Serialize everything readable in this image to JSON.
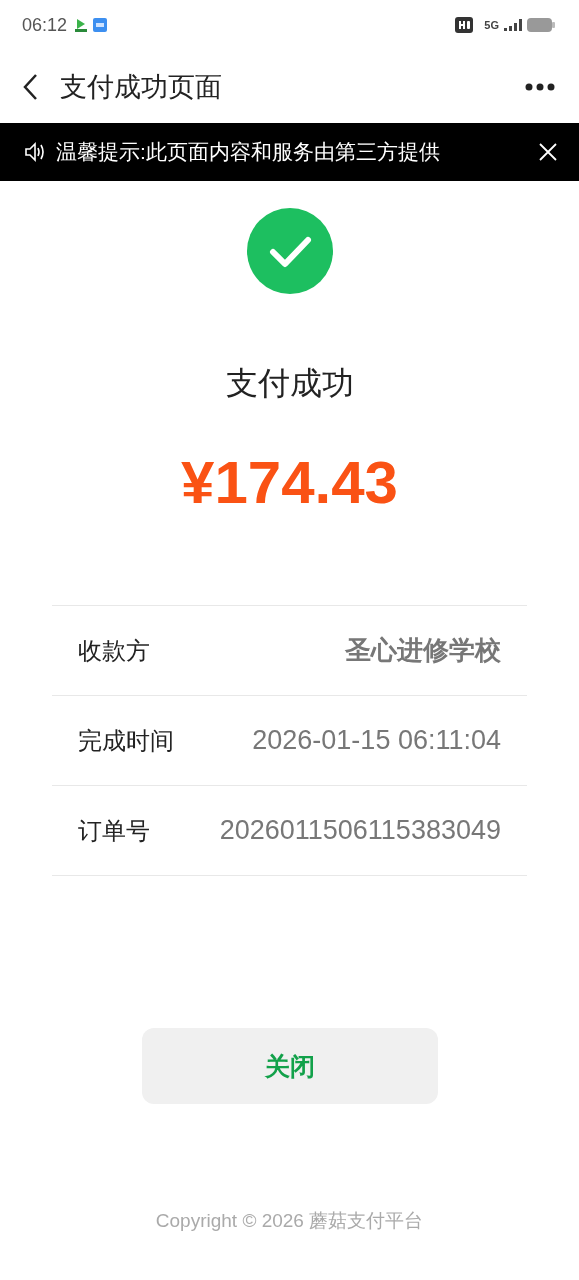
{
  "status_bar": {
    "time": "06:12",
    "network": "5G"
  },
  "nav": {
    "title": "支付成功页面"
  },
  "notice": {
    "text": "温馨提示:此页面内容和服务由第三方提供"
  },
  "result": {
    "title": "支付成功",
    "amount": "¥174.43"
  },
  "details": [
    {
      "label": "收款方",
      "value": "圣心进修学校",
      "emphasized": true
    },
    {
      "label": "完成时间",
      "value": "2026-01-15 06:11:04",
      "emphasized": false
    },
    {
      "label": "订单号",
      "value": "2026011506115383049",
      "emphasized": false
    }
  ],
  "close_button": "关闭",
  "footer": "Copyright © 2026 蘑菇支付平台"
}
